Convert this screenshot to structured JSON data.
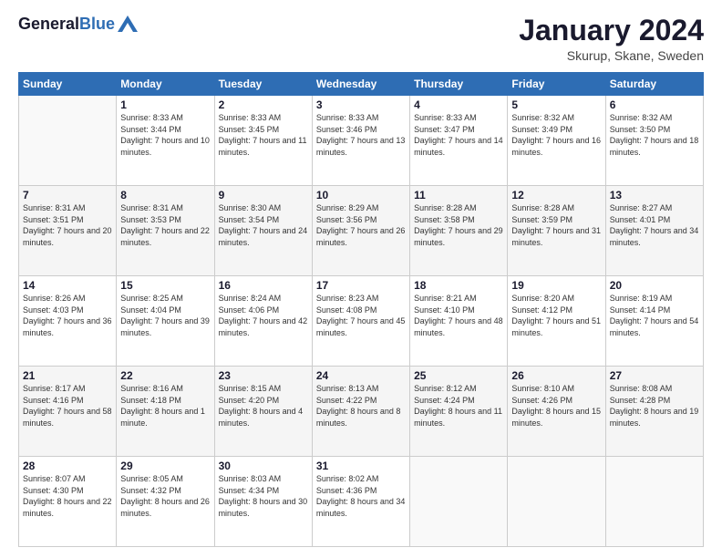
{
  "header": {
    "logo_general": "General",
    "logo_blue": "Blue",
    "month_title": "January 2024",
    "location": "Skurup, Skane, Sweden"
  },
  "days_of_week": [
    "Sunday",
    "Monday",
    "Tuesday",
    "Wednesday",
    "Thursday",
    "Friday",
    "Saturday"
  ],
  "weeks": [
    [
      {
        "day": "",
        "sunrise": "",
        "sunset": "",
        "daylight": ""
      },
      {
        "day": "1",
        "sunrise": "Sunrise: 8:33 AM",
        "sunset": "Sunset: 3:44 PM",
        "daylight": "Daylight: 7 hours and 10 minutes."
      },
      {
        "day": "2",
        "sunrise": "Sunrise: 8:33 AM",
        "sunset": "Sunset: 3:45 PM",
        "daylight": "Daylight: 7 hours and 11 minutes."
      },
      {
        "day": "3",
        "sunrise": "Sunrise: 8:33 AM",
        "sunset": "Sunset: 3:46 PM",
        "daylight": "Daylight: 7 hours and 13 minutes."
      },
      {
        "day": "4",
        "sunrise": "Sunrise: 8:33 AM",
        "sunset": "Sunset: 3:47 PM",
        "daylight": "Daylight: 7 hours and 14 minutes."
      },
      {
        "day": "5",
        "sunrise": "Sunrise: 8:32 AM",
        "sunset": "Sunset: 3:49 PM",
        "daylight": "Daylight: 7 hours and 16 minutes."
      },
      {
        "day": "6",
        "sunrise": "Sunrise: 8:32 AM",
        "sunset": "Sunset: 3:50 PM",
        "daylight": "Daylight: 7 hours and 18 minutes."
      }
    ],
    [
      {
        "day": "7",
        "sunrise": "Sunrise: 8:31 AM",
        "sunset": "Sunset: 3:51 PM",
        "daylight": "Daylight: 7 hours and 20 minutes."
      },
      {
        "day": "8",
        "sunrise": "Sunrise: 8:31 AM",
        "sunset": "Sunset: 3:53 PM",
        "daylight": "Daylight: 7 hours and 22 minutes."
      },
      {
        "day": "9",
        "sunrise": "Sunrise: 8:30 AM",
        "sunset": "Sunset: 3:54 PM",
        "daylight": "Daylight: 7 hours and 24 minutes."
      },
      {
        "day": "10",
        "sunrise": "Sunrise: 8:29 AM",
        "sunset": "Sunset: 3:56 PM",
        "daylight": "Daylight: 7 hours and 26 minutes."
      },
      {
        "day": "11",
        "sunrise": "Sunrise: 8:28 AM",
        "sunset": "Sunset: 3:58 PM",
        "daylight": "Daylight: 7 hours and 29 minutes."
      },
      {
        "day": "12",
        "sunrise": "Sunrise: 8:28 AM",
        "sunset": "Sunset: 3:59 PM",
        "daylight": "Daylight: 7 hours and 31 minutes."
      },
      {
        "day": "13",
        "sunrise": "Sunrise: 8:27 AM",
        "sunset": "Sunset: 4:01 PM",
        "daylight": "Daylight: 7 hours and 34 minutes."
      }
    ],
    [
      {
        "day": "14",
        "sunrise": "Sunrise: 8:26 AM",
        "sunset": "Sunset: 4:03 PM",
        "daylight": "Daylight: 7 hours and 36 minutes."
      },
      {
        "day": "15",
        "sunrise": "Sunrise: 8:25 AM",
        "sunset": "Sunset: 4:04 PM",
        "daylight": "Daylight: 7 hours and 39 minutes."
      },
      {
        "day": "16",
        "sunrise": "Sunrise: 8:24 AM",
        "sunset": "Sunset: 4:06 PM",
        "daylight": "Daylight: 7 hours and 42 minutes."
      },
      {
        "day": "17",
        "sunrise": "Sunrise: 8:23 AM",
        "sunset": "Sunset: 4:08 PM",
        "daylight": "Daylight: 7 hours and 45 minutes."
      },
      {
        "day": "18",
        "sunrise": "Sunrise: 8:21 AM",
        "sunset": "Sunset: 4:10 PM",
        "daylight": "Daylight: 7 hours and 48 minutes."
      },
      {
        "day": "19",
        "sunrise": "Sunrise: 8:20 AM",
        "sunset": "Sunset: 4:12 PM",
        "daylight": "Daylight: 7 hours and 51 minutes."
      },
      {
        "day": "20",
        "sunrise": "Sunrise: 8:19 AM",
        "sunset": "Sunset: 4:14 PM",
        "daylight": "Daylight: 7 hours and 54 minutes."
      }
    ],
    [
      {
        "day": "21",
        "sunrise": "Sunrise: 8:17 AM",
        "sunset": "Sunset: 4:16 PM",
        "daylight": "Daylight: 7 hours and 58 minutes."
      },
      {
        "day": "22",
        "sunrise": "Sunrise: 8:16 AM",
        "sunset": "Sunset: 4:18 PM",
        "daylight": "Daylight: 8 hours and 1 minute."
      },
      {
        "day": "23",
        "sunrise": "Sunrise: 8:15 AM",
        "sunset": "Sunset: 4:20 PM",
        "daylight": "Daylight: 8 hours and 4 minutes."
      },
      {
        "day": "24",
        "sunrise": "Sunrise: 8:13 AM",
        "sunset": "Sunset: 4:22 PM",
        "daylight": "Daylight: 8 hours and 8 minutes."
      },
      {
        "day": "25",
        "sunrise": "Sunrise: 8:12 AM",
        "sunset": "Sunset: 4:24 PM",
        "daylight": "Daylight: 8 hours and 11 minutes."
      },
      {
        "day": "26",
        "sunrise": "Sunrise: 8:10 AM",
        "sunset": "Sunset: 4:26 PM",
        "daylight": "Daylight: 8 hours and 15 minutes."
      },
      {
        "day": "27",
        "sunrise": "Sunrise: 8:08 AM",
        "sunset": "Sunset: 4:28 PM",
        "daylight": "Daylight: 8 hours and 19 minutes."
      }
    ],
    [
      {
        "day": "28",
        "sunrise": "Sunrise: 8:07 AM",
        "sunset": "Sunset: 4:30 PM",
        "daylight": "Daylight: 8 hours and 22 minutes."
      },
      {
        "day": "29",
        "sunrise": "Sunrise: 8:05 AM",
        "sunset": "Sunset: 4:32 PM",
        "daylight": "Daylight: 8 hours and 26 minutes."
      },
      {
        "day": "30",
        "sunrise": "Sunrise: 8:03 AM",
        "sunset": "Sunset: 4:34 PM",
        "daylight": "Daylight: 8 hours and 30 minutes."
      },
      {
        "day": "31",
        "sunrise": "Sunrise: 8:02 AM",
        "sunset": "Sunset: 4:36 PM",
        "daylight": "Daylight: 8 hours and 34 minutes."
      },
      {
        "day": "",
        "sunrise": "",
        "sunset": "",
        "daylight": ""
      },
      {
        "day": "",
        "sunrise": "",
        "sunset": "",
        "daylight": ""
      },
      {
        "day": "",
        "sunrise": "",
        "sunset": "",
        "daylight": ""
      }
    ]
  ]
}
